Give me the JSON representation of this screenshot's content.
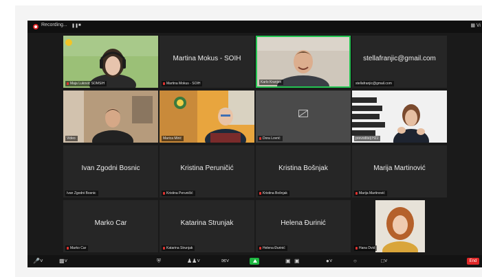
{
  "topbar": {
    "recording_label": "Recording...",
    "view_label": "Vi"
  },
  "participants": [
    {
      "name": "Maja Lukovic SOMSIH",
      "display": "",
      "video": "woman-headphones"
    },
    {
      "name": "Martina Mokus - SOIH",
      "display": "Martina Mokus - SOIH",
      "video": "none"
    },
    {
      "name": "Karlo Kranjen",
      "display": "",
      "video": "man-smiling"
    },
    {
      "name": "stellafranjic@gmail.com",
      "display": "stellafranjic@gmail.com",
      "video": "none"
    },
    {
      "name": "Video",
      "display": "",
      "video": "young-man"
    },
    {
      "name": "Marica Mirić",
      "display": "",
      "video": "older-woman"
    },
    {
      "name": "Dora Lovrić",
      "display": "",
      "video": "camera-off"
    },
    {
      "name": "prevoditelj HZJ",
      "display": "",
      "video": "sign-interpreter"
    },
    {
      "name": "Ivan Zgodni Bosnic",
      "display": "Ivan Zgodni Bosnic",
      "video": "none"
    },
    {
      "name": "Kristina Peruničić",
      "display": "Kristina Peruničić",
      "video": "none"
    },
    {
      "name": "Kristina Bošnjak",
      "display": "Kristina Bošnjak",
      "video": "none"
    },
    {
      "name": "Marija Martinović",
      "display": "Marija Martinović",
      "video": "none"
    },
    {
      "name": "Marko Car",
      "display": "Marko Car",
      "video": "none"
    },
    {
      "name": "Katarina Strunjak",
      "display": "Katarina Strunjak",
      "video": "none"
    },
    {
      "name": "Helena Đurinić",
      "display": "Helena Đurinić",
      "video": "none"
    },
    {
      "name": "Hana Dvid",
      "display": "",
      "video": "curly-hair-woman"
    }
  ],
  "active_speaker_index": 2,
  "colors": {
    "active_border": "#23c552",
    "end_button": "#e02828",
    "share_button": "#1fb842",
    "tile_background": "#262626"
  },
  "bottombar": {
    "end_label": "End",
    "icons": [
      "microphone-icon",
      "video-camera-icon",
      "security-icon",
      "participants-icon",
      "chat-icon",
      "share-screen-icon",
      "record-icon",
      "reactions-icon",
      "apps-icon",
      "whiteboard-icon",
      "more-icon"
    ]
  }
}
